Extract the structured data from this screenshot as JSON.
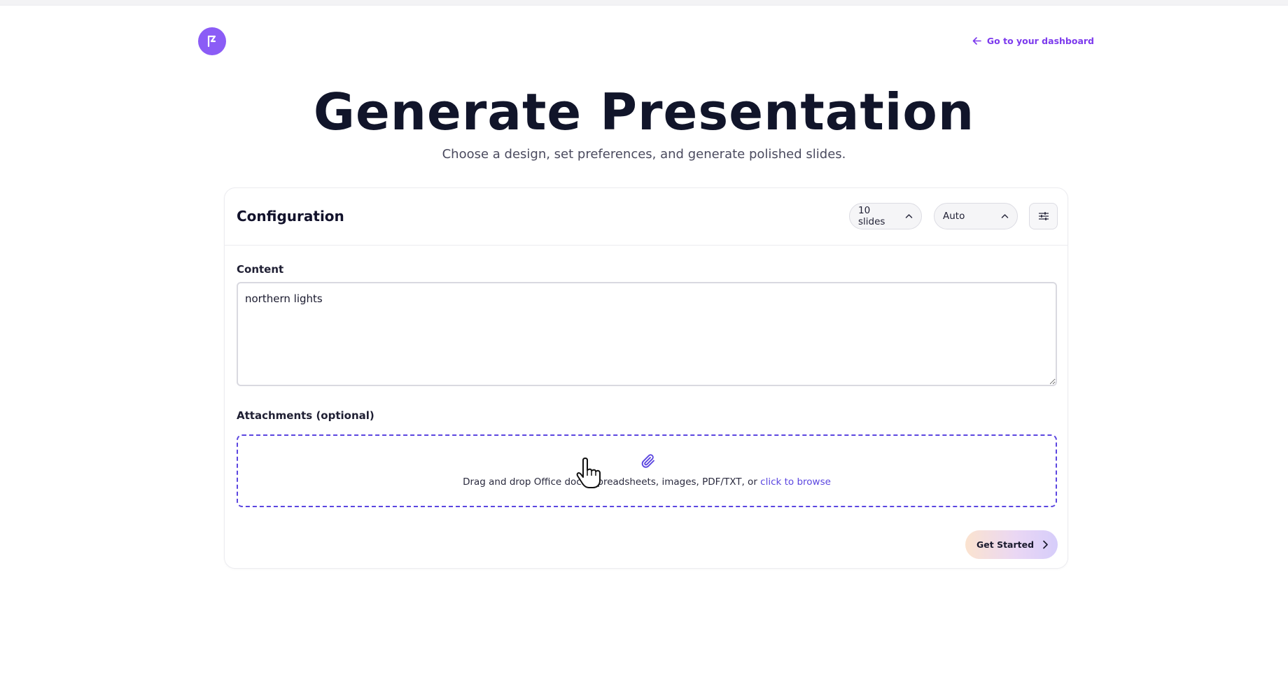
{
  "header": {
    "logo_icon": "presentation-logo-icon",
    "dashboard_link": "Go to your dashboard"
  },
  "page": {
    "title": "Generate Presentation",
    "subtitle": "Choose a design, set preferences, and generate polished slides."
  },
  "config": {
    "title": "Configuration",
    "slides_select": "10 slides",
    "theme_select": "Auto",
    "settings_icon": "sliders-icon"
  },
  "content": {
    "label": "Content",
    "value": "northern lights"
  },
  "attachments": {
    "label": "Attachments (optional)",
    "drop_text": "Drag and drop Office docs, spreadsheets, images, PDF/TXT, or ",
    "browse_link": "click to browse",
    "icon": "paperclip-icon"
  },
  "actions": {
    "get_started": "Get Started"
  },
  "colors": {
    "accent": "#7c3aed",
    "logo_bg": "#8b5cf6",
    "dropzone_border": "#5b46e0",
    "title": "#11152a"
  }
}
